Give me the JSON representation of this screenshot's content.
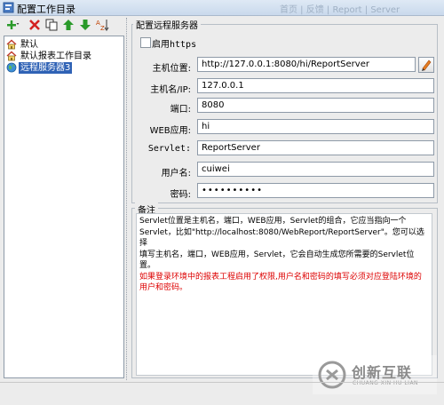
{
  "window": {
    "title": "配置工作目录",
    "background_title": "首页 | 反馈 | Report | Server",
    "accent": "#2f62b5"
  },
  "toolbar": {
    "buttons": [
      {
        "name": "add-button",
        "icon": "plus-icon",
        "color": "#2a9a2a"
      },
      {
        "name": "delete-button",
        "icon": "close-icon",
        "color": "#d32222"
      },
      {
        "name": "copy-button",
        "icon": "copy-icon",
        "color": "#333333"
      },
      {
        "name": "move-up-button",
        "icon": "arrow-up-icon",
        "color": "#2a9a2a"
      },
      {
        "name": "move-down-button",
        "icon": "arrow-down-icon",
        "color": "#2a9a2a"
      },
      {
        "name": "sort-button",
        "icon": "sort-icon",
        "color": "#c04000"
      }
    ]
  },
  "tree": {
    "items": [
      {
        "label": "默认",
        "icon": "home-icon",
        "selected": false
      },
      {
        "label": "默认报表工作目录",
        "icon": "home-icon",
        "selected": false
      },
      {
        "label": "远程服务器3",
        "icon": "globe-icon",
        "selected": true
      }
    ]
  },
  "form": {
    "group_title": "配置远程服务器",
    "https_label": "启用https",
    "https_checked": false,
    "fields": {
      "url": {
        "label": "主机位置:",
        "value": "http://127.0.0.1:8080/hi/ReportServer"
      },
      "host": {
        "label": "主机名/IP:",
        "value": "127.0.0.1"
      },
      "port": {
        "label": "端口:",
        "value": "8080"
      },
      "webapp": {
        "label": "WEB应用:",
        "value": "hi"
      },
      "servlet": {
        "label": "Servlet:",
        "value": "ReportServer"
      },
      "username": {
        "label": "用户名:",
        "value": "cuiwei"
      },
      "password": {
        "label": "密码:",
        "value": "••••••••••"
      }
    }
  },
  "notes": {
    "title": "备注",
    "lines": [
      "Servlet位置是主机名，端口，WEB应用，Servlet的组合，它应当指向一个",
      "Servlet，比如\"http://localhost:8080/WebReport/ReportServer\"。您可以选择",
      "填写主机名，端口，WEB应用，Servlet，它会自动生成您所需要的Servlet位置。"
    ],
    "warning_lines": [
      "如果登录环境中的报表工程启用了权限,用户名和密码的填写必须对应登陆环境的",
      "用户和密码。"
    ]
  },
  "watermark": {
    "text_cn": "创新互联",
    "text_en": "CHUANG XIN HU LIAN"
  }
}
